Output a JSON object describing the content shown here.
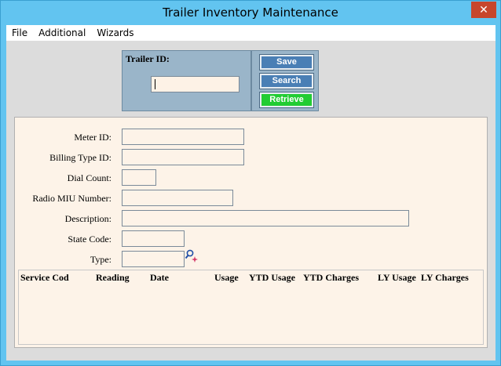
{
  "window": {
    "title": "Trailer Inventory Maintenance",
    "close_glyph": "✕"
  },
  "menu": {
    "items": [
      {
        "label": "File"
      },
      {
        "label": "Additional"
      },
      {
        "label": "Wizards"
      }
    ]
  },
  "trailer_id": {
    "label": "Trailer ID:",
    "value": ""
  },
  "actions": {
    "save": "Save",
    "search": "Search",
    "retrieve": "Retrieve"
  },
  "fields": {
    "meter_id": {
      "label": "Meter ID:",
      "value": ""
    },
    "billing_type_id": {
      "label": "Billing Type ID:",
      "value": ""
    },
    "dial_count": {
      "label": "Dial Count:",
      "value": ""
    },
    "radio_miu_number": {
      "label": "Radio MIU Number:",
      "value": ""
    },
    "description": {
      "label": "Description:",
      "value": ""
    },
    "state_code": {
      "label": "State Code:",
      "value": ""
    },
    "type": {
      "label": "Type:",
      "value": ""
    }
  },
  "grid": {
    "columns": [
      "Service Cod",
      "Reading",
      "Date",
      "Usage",
      "YTD Usage",
      "YTD Charges",
      "LY Usage",
      "LY Charges"
    ],
    "rows": []
  },
  "colors": {
    "titlebar": "#62c4f0",
    "close": "#c7462c",
    "panel": "#9ab5c9",
    "button": "#4a7fb5",
    "retrieve": "#22cc33",
    "form_bg": "#fdf3e8"
  },
  "icons": {
    "close": "close-icon",
    "lookup": "lookup-magnifier-icon"
  }
}
